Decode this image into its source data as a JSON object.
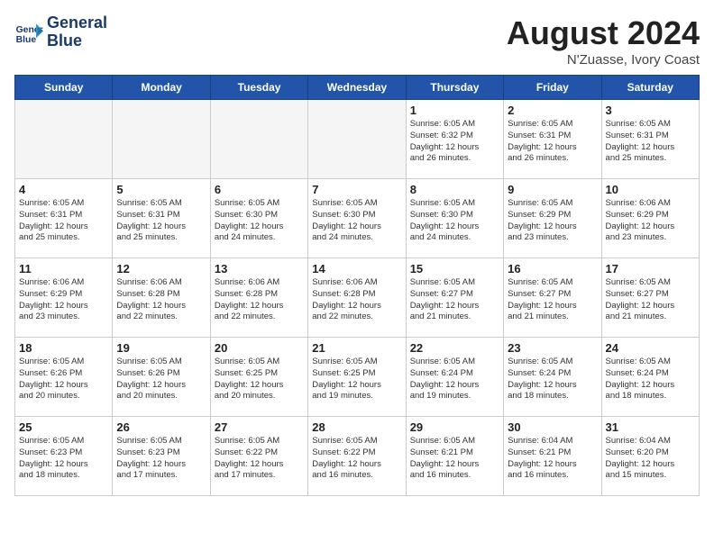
{
  "header": {
    "logo_line1": "General",
    "logo_line2": "Blue",
    "month_year": "August 2024",
    "location": "N'Zuasse, Ivory Coast"
  },
  "days_of_week": [
    "Sunday",
    "Monday",
    "Tuesday",
    "Wednesday",
    "Thursday",
    "Friday",
    "Saturday"
  ],
  "weeks": [
    [
      {
        "day": "",
        "info": ""
      },
      {
        "day": "",
        "info": ""
      },
      {
        "day": "",
        "info": ""
      },
      {
        "day": "",
        "info": ""
      },
      {
        "day": "1",
        "info": "Sunrise: 6:05 AM\nSunset: 6:32 PM\nDaylight: 12 hours\nand 26 minutes."
      },
      {
        "day": "2",
        "info": "Sunrise: 6:05 AM\nSunset: 6:31 PM\nDaylight: 12 hours\nand 26 minutes."
      },
      {
        "day": "3",
        "info": "Sunrise: 6:05 AM\nSunset: 6:31 PM\nDaylight: 12 hours\nand 25 minutes."
      }
    ],
    [
      {
        "day": "4",
        "info": "Sunrise: 6:05 AM\nSunset: 6:31 PM\nDaylight: 12 hours\nand 25 minutes."
      },
      {
        "day": "5",
        "info": "Sunrise: 6:05 AM\nSunset: 6:31 PM\nDaylight: 12 hours\nand 25 minutes."
      },
      {
        "day": "6",
        "info": "Sunrise: 6:05 AM\nSunset: 6:30 PM\nDaylight: 12 hours\nand 24 minutes."
      },
      {
        "day": "7",
        "info": "Sunrise: 6:05 AM\nSunset: 6:30 PM\nDaylight: 12 hours\nand 24 minutes."
      },
      {
        "day": "8",
        "info": "Sunrise: 6:05 AM\nSunset: 6:30 PM\nDaylight: 12 hours\nand 24 minutes."
      },
      {
        "day": "9",
        "info": "Sunrise: 6:05 AM\nSunset: 6:29 PM\nDaylight: 12 hours\nand 23 minutes."
      },
      {
        "day": "10",
        "info": "Sunrise: 6:06 AM\nSunset: 6:29 PM\nDaylight: 12 hours\nand 23 minutes."
      }
    ],
    [
      {
        "day": "11",
        "info": "Sunrise: 6:06 AM\nSunset: 6:29 PM\nDaylight: 12 hours\nand 23 minutes."
      },
      {
        "day": "12",
        "info": "Sunrise: 6:06 AM\nSunset: 6:28 PM\nDaylight: 12 hours\nand 22 minutes."
      },
      {
        "day": "13",
        "info": "Sunrise: 6:06 AM\nSunset: 6:28 PM\nDaylight: 12 hours\nand 22 minutes."
      },
      {
        "day": "14",
        "info": "Sunrise: 6:06 AM\nSunset: 6:28 PM\nDaylight: 12 hours\nand 22 minutes."
      },
      {
        "day": "15",
        "info": "Sunrise: 6:05 AM\nSunset: 6:27 PM\nDaylight: 12 hours\nand 21 minutes."
      },
      {
        "day": "16",
        "info": "Sunrise: 6:05 AM\nSunset: 6:27 PM\nDaylight: 12 hours\nand 21 minutes."
      },
      {
        "day": "17",
        "info": "Sunrise: 6:05 AM\nSunset: 6:27 PM\nDaylight: 12 hours\nand 21 minutes."
      }
    ],
    [
      {
        "day": "18",
        "info": "Sunrise: 6:05 AM\nSunset: 6:26 PM\nDaylight: 12 hours\nand 20 minutes."
      },
      {
        "day": "19",
        "info": "Sunrise: 6:05 AM\nSunset: 6:26 PM\nDaylight: 12 hours\nand 20 minutes."
      },
      {
        "day": "20",
        "info": "Sunrise: 6:05 AM\nSunset: 6:25 PM\nDaylight: 12 hours\nand 20 minutes."
      },
      {
        "day": "21",
        "info": "Sunrise: 6:05 AM\nSunset: 6:25 PM\nDaylight: 12 hours\nand 19 minutes."
      },
      {
        "day": "22",
        "info": "Sunrise: 6:05 AM\nSunset: 6:24 PM\nDaylight: 12 hours\nand 19 minutes."
      },
      {
        "day": "23",
        "info": "Sunrise: 6:05 AM\nSunset: 6:24 PM\nDaylight: 12 hours\nand 18 minutes."
      },
      {
        "day": "24",
        "info": "Sunrise: 6:05 AM\nSunset: 6:24 PM\nDaylight: 12 hours\nand 18 minutes."
      }
    ],
    [
      {
        "day": "25",
        "info": "Sunrise: 6:05 AM\nSunset: 6:23 PM\nDaylight: 12 hours\nand 18 minutes."
      },
      {
        "day": "26",
        "info": "Sunrise: 6:05 AM\nSunset: 6:23 PM\nDaylight: 12 hours\nand 17 minutes."
      },
      {
        "day": "27",
        "info": "Sunrise: 6:05 AM\nSunset: 6:22 PM\nDaylight: 12 hours\nand 17 minutes."
      },
      {
        "day": "28",
        "info": "Sunrise: 6:05 AM\nSunset: 6:22 PM\nDaylight: 12 hours\nand 16 minutes."
      },
      {
        "day": "29",
        "info": "Sunrise: 6:05 AM\nSunset: 6:21 PM\nDaylight: 12 hours\nand 16 minutes."
      },
      {
        "day": "30",
        "info": "Sunrise: 6:04 AM\nSunset: 6:21 PM\nDaylight: 12 hours\nand 16 minutes."
      },
      {
        "day": "31",
        "info": "Sunrise: 6:04 AM\nSunset: 6:20 PM\nDaylight: 12 hours\nand 15 minutes."
      }
    ]
  ]
}
